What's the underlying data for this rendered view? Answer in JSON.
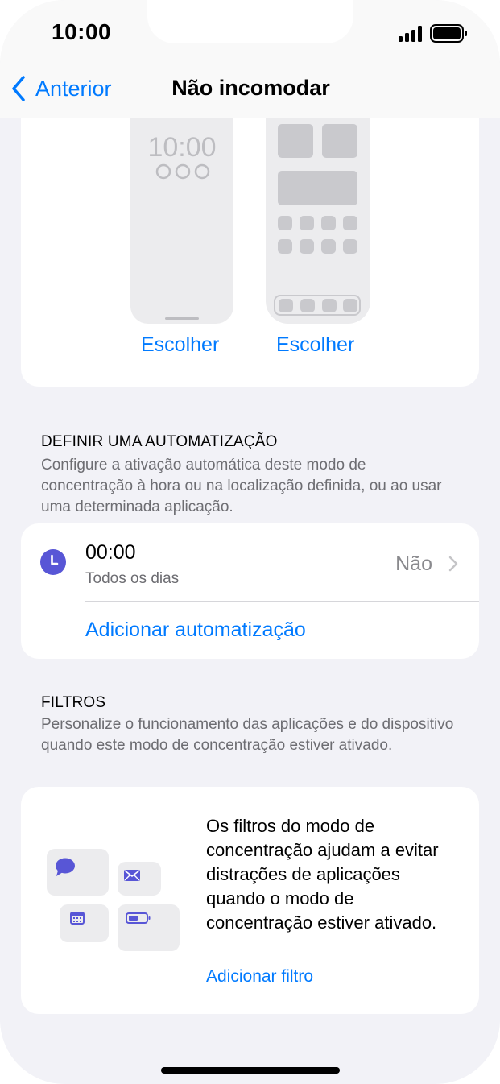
{
  "status_bar": {
    "time": "10:00"
  },
  "nav": {
    "back_label": "Anterior",
    "title": "Não incomodar"
  },
  "previews": {
    "lock_time": "10:00",
    "lock_choose_label": "Escolher",
    "home_choose_label": "Escolher"
  },
  "automation": {
    "header": "DEFINIR UMA AUTOMATIZAÇÃO",
    "description": "Configure a ativação automática deste modo de concentração à hora ou na localização definida, ou ao usar uma determinada aplicação.",
    "item": {
      "time": "00:00",
      "subtitle": "Todos os dias",
      "value": "Não"
    },
    "add_label": "Adicionar automatização"
  },
  "filters": {
    "header": "FILTROS",
    "description": "Personalize o funcionamento das aplicações e do dispositivo quando este modo de concentração estiver ativado.",
    "info_text": "Os filtros do modo de concentração ajudam a evitar distrações de aplicações quando o modo de concentração estiver ativado.",
    "add_label": "Adicionar filtro"
  },
  "colors": {
    "accent": "#007aff",
    "focus_purple": "#5856d6",
    "background": "#f2f2f7",
    "secondary_text": "#6d6d72"
  },
  "icons": [
    "chevron-left-icon",
    "signal-icon",
    "battery-icon",
    "clock-icon",
    "chevron-right-icon",
    "message-icon",
    "mail-icon",
    "calendar-icon",
    "battery-small-icon"
  ]
}
